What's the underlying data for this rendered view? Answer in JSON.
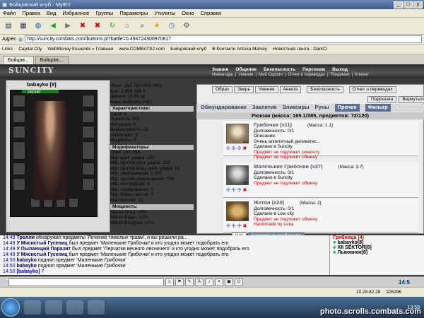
{
  "window": {
    "title": "Бойцовский клуб - MyIE2"
  },
  "menu": [
    "Файл",
    "Правка",
    "Вид",
    "Избранное",
    "Группы",
    "Параметры",
    "Утилиты",
    "Окно",
    "Справка"
  ],
  "address": {
    "label": "Адрес",
    "url": "http://suncity.combats.com/buttons.pl?battle=0.494724300970617"
  },
  "links": {
    "label": "Links",
    "items": [
      "Capital City",
      "WebMoney Кошелёк » Главная",
      "www.COMBATS2.com",
      "Бойцовский клуб",
      "В Контакте Antoxa Matvey",
      "Новостная лента - DarkCi"
    ]
  },
  "tabs": [
    "Бойцов...",
    "Бойцовс..."
  ],
  "game": {
    "logo": "SUNCITY",
    "nav": [
      "Знания",
      "Общение",
      "Безопасность",
      "Персонаж",
      "Выход"
    ],
    "subnav": [
      "Инвентарь",
      "Умения",
      "Мой Скролл",
      "Отчет о переводах",
      "Поединки",
      "Клиент"
    ]
  },
  "character": {
    "name": "babayko [8]",
    "hp": "240/240",
    "stats_top": [
      "Опыт: 351 752 (400 000)",
      "Бои: 1 858  338  4",
      "Деньги: 16.66 кр.",
      "Банк: выбрать счёт"
    ],
    "characteristics_title": "Характеристики:",
    "characteristics": [
      "Сила: 8",
      "Ловкость: 100",
      "Интуиция: 8",
      "Выносливость: 25",
      "Интеллект: 5",
      "Мудрость: 0"
    ],
    "modifiers_title": "Модификаторы:",
    "modifiers": [
      "Урон: 131-158",
      "Мф. крит. удара: 103",
      "Мф. против крит. удара: 220",
      "Мф. против мощ. крит. удара: 12",
      "Мф. увертывания: 1 297",
      "Мф. против увертывания: 759",
      "Мф. контрудара: 0",
      "Мф. парирования: 0",
      "Мф. блока щитом: 0",
      "Мастерство: 12"
    ],
    "power_title": "Мощность:",
    "power": [
      "Магия Огня: +2%",
      "Магия Воды: +2%",
      "Магия Воздуха: +2%"
    ]
  },
  "top_buttons": [
    "Образ",
    "Зверь",
    "Умения",
    "Анкета",
    "Безопасность",
    "Отчет о переводах"
  ],
  "hint_buttons": [
    "Подсказка",
    "Вернуться"
  ],
  "bag_tabs": [
    "Обмундирование",
    "Заклятия",
    "Эликсиры",
    "Руны",
    "Прочее",
    "Фильтр"
  ],
  "backpack": "Рюкзак (масса: 165.1/385, предметов: 72/120)",
  "items": [
    {
      "name": "Грибочки (x11)",
      "mass": "(Масса: 1.1)",
      "durability": "Долговечность: 0/1",
      "desc1": "Описание:",
      "desc2": "Очень аппетитный деликатес...",
      "made": "Сделано в Suncity",
      "warn1": "Предмет не подлежит ремонту",
      "warn2": "Предмет не подлежит обмену",
      "count": "x11"
    },
    {
      "name": "Маленькие Грибочки (x37)",
      "mass": "(Масса: 3.7)",
      "durability": "Долговечность: 0/1",
      "desc1": "",
      "desc2": "",
      "made": "Сделано в Suncity",
      "warn1": "Предмет не подлежит обмену",
      "warn2": "",
      "count": "x37"
    },
    {
      "name": "Жетон (x20)",
      "mass": "(Масса: 2)",
      "durability": "Долговечность: 0/1",
      "desc1": "",
      "desc2": "",
      "made": "Сделано в Low city",
      "warn1": "Предмет не подлежит обмену",
      "warn2": "Handmade by Luka",
      "count": "x20"
    }
  ],
  "chat_tabs": [
    "Чат",
    "Системные сообщения"
  ],
  "chat": [
    {
      "t": "14:49",
      "n": "Тролли",
      "m": "обнаружил предметы 'Лечение тяжелых травм', и вы решили ра..."
    },
    {
      "t": "14:49",
      "n": "У Мясистый Гусениц",
      "m": "был предмет 'Маленькие Грибочки' и кто угодно может подобрать его"
    },
    {
      "t": "14:49",
      "n": "У Пылающий Паразит",
      "m": "был предмет 'Перчатки вечного лесничего' и кто угодно может подобрать его"
    },
    {
      "t": "14:49",
      "n": "У Мясистый Гусениц",
      "m": "был предмет 'Маленькие Грибочки' и кто угодно может подобрать его"
    },
    {
      "t": "14:50",
      "n": "babayko",
      "m": "поднял предмет 'Маленькие Грибочки'"
    },
    {
      "t": "14:50",
      "n": "babayko",
      "m": "поднял предмет 'Маленькие Грибочки'"
    },
    {
      "t": "14:50",
      "n": "[babayko]",
      "m": "7"
    }
  ],
  "online": {
    "group": "Грибница (4)",
    "members": [
      "babayko[8]",
      "XII SEKTOR[8]",
      "Львовнок[8]"
    ]
  },
  "clock": "14:5",
  "status": {
    "ip": "10.28.82.28",
    "num": "326296",
    "time": "13:59"
  },
  "watermark": "photo.scrolls.combats.com"
}
